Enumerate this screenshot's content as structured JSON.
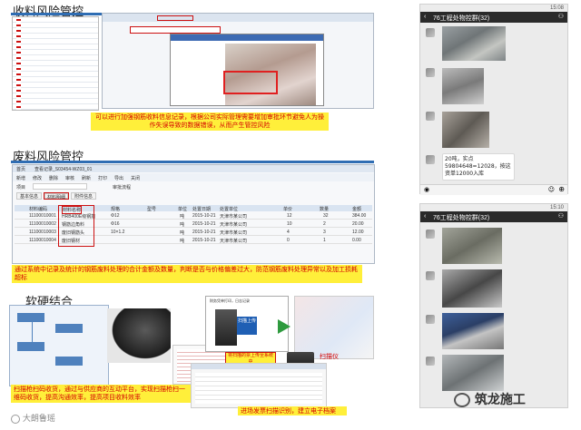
{
  "sections": {
    "s1_title": "收料风险管控",
    "s1_note": "可以进行加强钢筋收料信息记录，根据公司实际管理需要增加审批环节避免人为操作失误导致的数据错误，从而产生管控风险",
    "s2_title": "废料风险管控",
    "s2_note": "通过系统中记录及统计的钢筋废料处理的合计金额及数量，判断是否与价格偏差过大，防范钢筋废料处理异常以及加工损耗超标",
    "s3_title": "软硬结合",
    "s3_note_left": "扫描枪扫码收货，通过与供应商的互动平台，实现扫描枪扫一维码收货，提高沟通效率，提高项目收料效率",
    "s3_note_right": "进场发票扫描识别，建立电子档案",
    "s3_label_scanner": "扫描仪",
    "s3_label_upload": "扫描上传",
    "s3_label_flow": "将扫描的票上传至系统中",
    "s3_doc_title": "财务凭单打印，日志记录"
  },
  "s2_window": {
    "tabs": [
      "首页",
      "查看记录_S03454-WZ03_01"
    ],
    "toolbar": [
      "新增",
      "修改",
      "删除",
      "审核",
      "刷新",
      "打印",
      "导出",
      "关闭"
    ],
    "form_labels": [
      "项目",
      "审批流程"
    ],
    "sub_tabs": [
      "基本信息",
      "材料明细",
      "附件信息"
    ],
    "columns": [
      "材料编码",
      "材料名称",
      "规格",
      "型号",
      "单位",
      "处置日期",
      "处置单位",
      "单价",
      "数量",
      "金额"
    ],
    "rows": [
      [
        "11100010001",
        "HRB400E级钢筋",
        "Φ12",
        "",
        "吨",
        "2015-10-21",
        "天津市某公司",
        "12",
        "32",
        "384.00"
      ],
      [
        "11100010002",
        "钢筋边角料",
        "Φ16",
        "",
        "吨",
        "2015-10-21",
        "天津市某公司",
        "10",
        "2",
        "20.00"
      ],
      [
        "11100010003",
        "废旧钢筋头",
        "10×1.2",
        "",
        "吨",
        "2015-10-21",
        "天津市某公司",
        "4",
        "3",
        "12.00"
      ],
      [
        "11100010004",
        "废旧钢材",
        "",
        "",
        "吨",
        "2015-10-21",
        "天津市某公司",
        "0",
        "1",
        "0.00"
      ]
    ]
  },
  "phone1": {
    "status_time": "15:08",
    "chat_title": "76工程处物控群(32)",
    "bubble_text": "20吨，实点59804648=12028，按这资单12000入库"
  },
  "phone2": {
    "status_time": "15:10",
    "chat_title": "76工程处物控群(32)"
  },
  "watermark_left": "大朗鲁瑶",
  "watermark_right": "筑龙施工",
  "colors": {
    "note_bg": "#ffef3a",
    "note_text": "#d40000",
    "accent_red": "#cc1010",
    "header_blue": "#d9e4f1"
  }
}
